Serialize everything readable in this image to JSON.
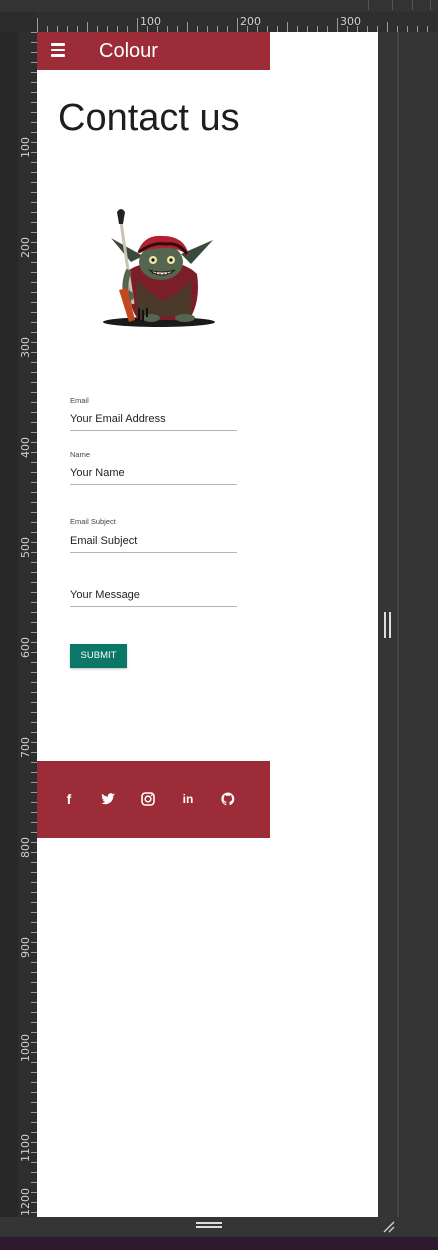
{
  "ruler": {
    "h_labels": [
      "100",
      "200",
      "300"
    ],
    "v_labels": [
      "100",
      "200",
      "300",
      "400",
      "500",
      "600",
      "700",
      "800",
      "900",
      "1000",
      "1100",
      "1200"
    ]
  },
  "header": {
    "menu_icon": "hamburger-icon",
    "brand": "Colour",
    "color": "#9b2c38"
  },
  "page": {
    "title": "Contact us"
  },
  "form": {
    "email": {
      "label": "Email",
      "placeholder": "Your Email Address"
    },
    "name": {
      "label": "Name",
      "placeholder": "Your Name"
    },
    "subject": {
      "label": "Email Subject",
      "placeholder": "Email Subject"
    },
    "message": {
      "label": "",
      "placeholder": "Your Message"
    },
    "submit_label": "SUBMIT",
    "submit_color": "#0b7766"
  },
  "footer": {
    "color": "#9b2c38",
    "social": [
      {
        "name": "facebook-icon",
        "glyph": "f"
      },
      {
        "name": "twitter-icon",
        "glyph": ""
      },
      {
        "name": "instagram-icon",
        "glyph": ""
      },
      {
        "name": "linkedin-icon",
        "glyph": "in"
      },
      {
        "name": "github-icon",
        "glyph": ""
      }
    ]
  }
}
